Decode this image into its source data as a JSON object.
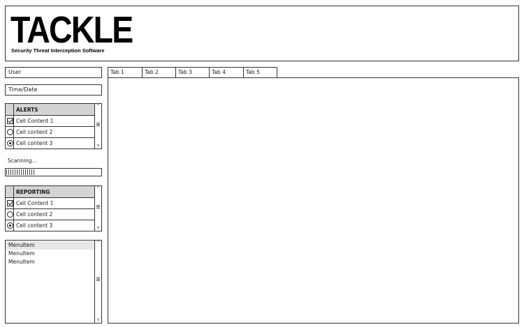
{
  "header": {
    "logo_text": "TACKLE",
    "tagline": "Security Threat Interception Software"
  },
  "fields": {
    "user": "User",
    "datetime": "Time/Date"
  },
  "alerts": {
    "title": "ALERTS",
    "rows": [
      {
        "control": "checkbox",
        "checked": true,
        "text": "Cell Content 1"
      },
      {
        "control": "radio",
        "checked": false,
        "text": "Cell content 2"
      },
      {
        "control": "radio",
        "checked": true,
        "text": "Cell content 3"
      }
    ]
  },
  "scanning": {
    "label": "Scanning...",
    "progress": 0.3
  },
  "reporting": {
    "title": "REPORTING",
    "rows": [
      {
        "control": "checkbox",
        "checked": true,
        "text": "Cell Content 1"
      },
      {
        "control": "radio",
        "checked": false,
        "text": "Cell content 2"
      },
      {
        "control": "radio",
        "checked": true,
        "text": "Cell content 3"
      }
    ]
  },
  "menu": {
    "items": [
      "MenuItem",
      "MenuItem",
      "MenuItem"
    ],
    "selected_index": 0
  },
  "tabs": [
    "Tab 1",
    "Tab 2",
    "Tab 3",
    "Tab 4",
    "Tab 5"
  ],
  "icons": {
    "checkbox": "checkbox-checked-icon",
    "radio_on": "radio-selected-icon",
    "radio_off": "radio-empty-icon",
    "scroll_up": "chevron-up-icon",
    "scroll_down": "chevron-down-icon"
  }
}
